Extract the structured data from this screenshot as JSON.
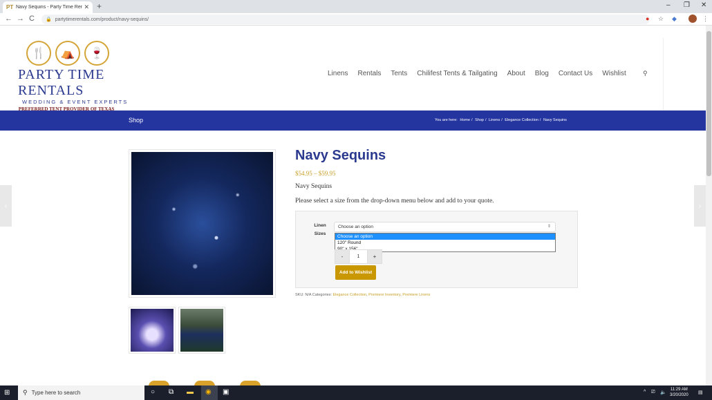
{
  "browser": {
    "tab_title": "Navy Sequins - Party Time Rentals",
    "tab_favicon": "PT",
    "new_tab_label": "+",
    "url": "partytimerentals.com/product/navy-sequins/",
    "nav": {
      "back": "←",
      "forward": "→",
      "reload": "C"
    }
  },
  "site": {
    "logo": {
      "name": "PARTY TIME RENTALS",
      "tagline": "WEDDING & EVENT EXPERTS",
      "preferred": "PREFERRED TENT PROVIDER OF TEXAS A&M ATHLETICS",
      "icons": [
        "fork-knife-icon",
        "tent-icon",
        "glasses-icon"
      ]
    },
    "nav_items": [
      "Linens",
      "Rentals",
      "Tents",
      "Chilifest Tents & Tailgating",
      "About",
      "Blog",
      "Contact Us",
      "Wishlist"
    ],
    "search_icon": "search-icon"
  },
  "title_bar": {
    "shop_label": "Shop",
    "breadcrumb_prefix": "You are here:",
    "breadcrumbs": [
      "Home",
      "Shop",
      "Linens",
      "Elegance Collection",
      "Navy Sequins"
    ]
  },
  "product": {
    "title": "Navy Sequins",
    "price": "$54.95 – $59.95",
    "short_description": "Navy Sequins",
    "instruction": "Please select a size from the drop-down menu below and add to your quote.",
    "variation_label_line1": "Linen",
    "variation_label_line2": "Sizes",
    "select_value": "Choose an option",
    "options": [
      "Choose an option",
      "120\" Round",
      "90\" x 156\""
    ],
    "quantity": "1",
    "qty_minus": "-",
    "qty_plus": "+",
    "add_button": "Add to Wishlist",
    "meta": {
      "sku_label": "SKU:",
      "sku_value": "N/A",
      "categories_label": "Categories:",
      "categories": [
        "Elegance Collection",
        "Premiere Inventory",
        "Premiere Linens"
      ]
    }
  },
  "taskbar": {
    "search_placeholder": "Type here to search",
    "time": "11:29 AM",
    "date": "3/20/2020"
  }
}
